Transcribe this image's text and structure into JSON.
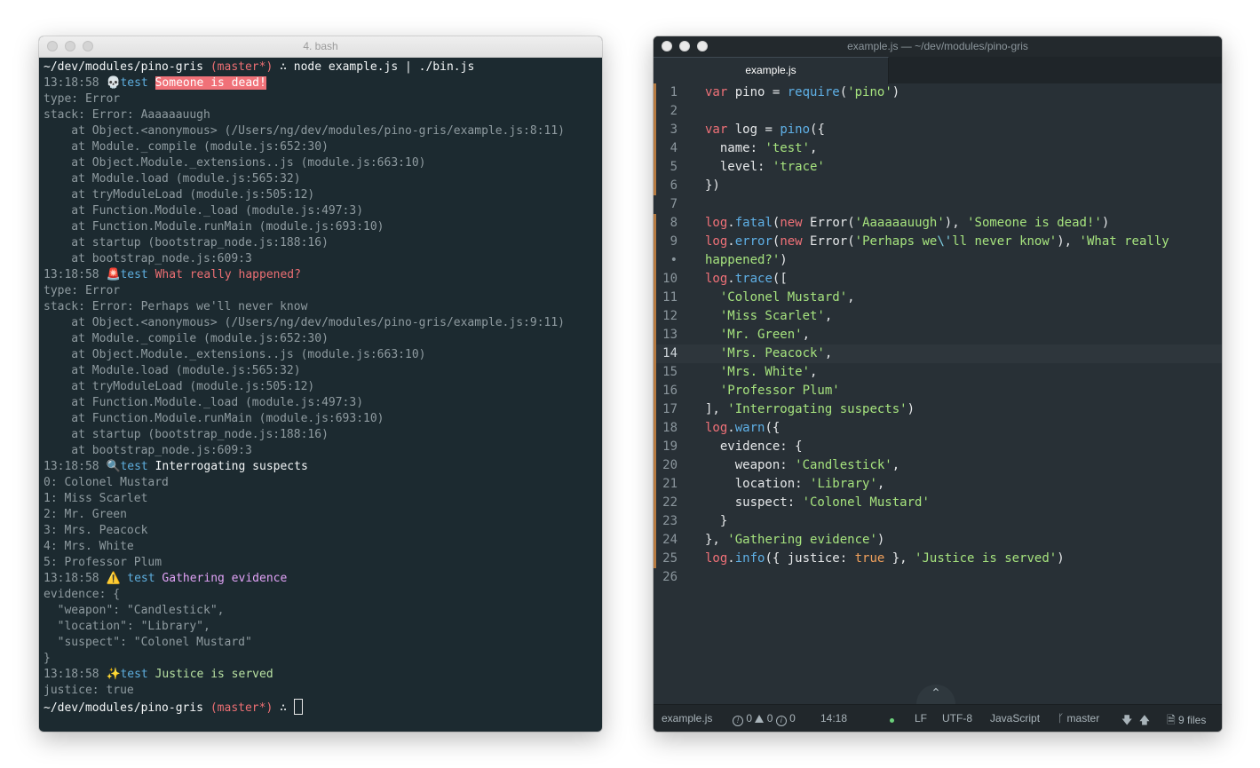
{
  "terminal": {
    "title": "4. bash",
    "lines": [
      {
        "segs": [
          {
            "t": "~/dev/modules/pino-gris ",
            "c": "wht"
          },
          {
            "t": "(master*)",
            "c": "pink"
          },
          {
            "t": " ∴ node example.js | ./bin.js",
            "c": "wht"
          }
        ]
      },
      {
        "segs": [
          {
            "t": "13:18:58 ",
            "c": "dim"
          },
          {
            "t": "💀",
            "c": "emo"
          },
          {
            "t": "test",
            "c": "blue"
          },
          {
            "t": " ",
            "c": "dim"
          },
          {
            "t": "Someone is dead!",
            "c": "hl"
          }
        ]
      },
      {
        "segs": [
          {
            "t": "type: Error",
            "c": "dim"
          }
        ]
      },
      {
        "segs": [
          {
            "t": "stack: Error: Aaaaaauugh",
            "c": "dim"
          }
        ]
      },
      {
        "segs": [
          {
            "t": "    at Object.<anonymous> (/Users/ng/dev/modules/pino-gris/example.js:8:11)",
            "c": "dim"
          }
        ]
      },
      {
        "segs": [
          {
            "t": "    at Module._compile (module.js:652:30)",
            "c": "dim"
          }
        ]
      },
      {
        "segs": [
          {
            "t": "    at Object.Module._extensions..js (module.js:663:10)",
            "c": "dim"
          }
        ]
      },
      {
        "segs": [
          {
            "t": "    at Module.load (module.js:565:32)",
            "c": "dim"
          }
        ]
      },
      {
        "segs": [
          {
            "t": "    at tryModuleLoad (module.js:505:12)",
            "c": "dim"
          }
        ]
      },
      {
        "segs": [
          {
            "t": "    at Function.Module._load (module.js:497:3)",
            "c": "dim"
          }
        ]
      },
      {
        "segs": [
          {
            "t": "    at Function.Module.runMain (module.js:693:10)",
            "c": "dim"
          }
        ]
      },
      {
        "segs": [
          {
            "t": "    at startup (bootstrap_node.js:188:16)",
            "c": "dim"
          }
        ]
      },
      {
        "segs": [
          {
            "t": "    at bootstrap_node.js:609:3",
            "c": "dim"
          }
        ]
      },
      {
        "segs": [
          {
            "t": "13:18:58 ",
            "c": "dim"
          },
          {
            "t": "🚨",
            "c": "emo"
          },
          {
            "t": "test",
            "c": "blue"
          },
          {
            "t": " What really happened?",
            "c": "pink"
          }
        ]
      },
      {
        "segs": [
          {
            "t": "type: Error",
            "c": "dim"
          }
        ]
      },
      {
        "segs": [
          {
            "t": "stack: Error: Perhaps we'll never know",
            "c": "dim"
          }
        ]
      },
      {
        "segs": [
          {
            "t": "    at Object.<anonymous> (/Users/ng/dev/modules/pino-gris/example.js:9:11)",
            "c": "dim"
          }
        ]
      },
      {
        "segs": [
          {
            "t": "    at Module._compile (module.js:652:30)",
            "c": "dim"
          }
        ]
      },
      {
        "segs": [
          {
            "t": "    at Object.Module._extensions..js (module.js:663:10)",
            "c": "dim"
          }
        ]
      },
      {
        "segs": [
          {
            "t": "    at Module.load (module.js:565:32)",
            "c": "dim"
          }
        ]
      },
      {
        "segs": [
          {
            "t": "    at tryModuleLoad (module.js:505:12)",
            "c": "dim"
          }
        ]
      },
      {
        "segs": [
          {
            "t": "    at Function.Module._load (module.js:497:3)",
            "c": "dim"
          }
        ]
      },
      {
        "segs": [
          {
            "t": "    at Function.Module.runMain (module.js:693:10)",
            "c": "dim"
          }
        ]
      },
      {
        "segs": [
          {
            "t": "    at startup (bootstrap_node.js:188:16)",
            "c": "dim"
          }
        ]
      },
      {
        "segs": [
          {
            "t": "    at bootstrap_node.js:609:3",
            "c": "dim"
          }
        ]
      },
      {
        "segs": [
          {
            "t": "13:18:58 ",
            "c": "dim"
          },
          {
            "t": "🔍",
            "c": "emo"
          },
          {
            "t": "test",
            "c": "blue"
          },
          {
            "t": " Interrogating suspects",
            "c": "wht"
          }
        ]
      },
      {
        "segs": [
          {
            "t": "0: Colonel Mustard",
            "c": "dim"
          }
        ]
      },
      {
        "segs": [
          {
            "t": "1: Miss Scarlet",
            "c": "dim"
          }
        ]
      },
      {
        "segs": [
          {
            "t": "2: Mr. Green",
            "c": "dim"
          }
        ]
      },
      {
        "segs": [
          {
            "t": "3: Mrs. Peacock",
            "c": "dim"
          }
        ]
      },
      {
        "segs": [
          {
            "t": "4: Mrs. White",
            "c": "dim"
          }
        ]
      },
      {
        "segs": [
          {
            "t": "5: Professor Plum",
            "c": "dim"
          }
        ]
      },
      {
        "segs": [
          {
            "t": "13:18:58 ",
            "c": "dim"
          },
          {
            "t": "⚠️",
            "c": "emo"
          },
          {
            "t": " test",
            "c": "blue"
          },
          {
            "t": " Gathering evidence",
            "c": "lav"
          }
        ]
      },
      {
        "segs": [
          {
            "t": "evidence: {",
            "c": "dim"
          }
        ]
      },
      {
        "segs": [
          {
            "t": "  \"weapon\": \"Candlestick\",",
            "c": "dim"
          }
        ]
      },
      {
        "segs": [
          {
            "t": "  \"location\": \"Library\",",
            "c": "dim"
          }
        ]
      },
      {
        "segs": [
          {
            "t": "  \"suspect\": \"Colonel Mustard\"",
            "c": "dim"
          }
        ]
      },
      {
        "segs": [
          {
            "t": "}",
            "c": "dim"
          }
        ]
      },
      {
        "segs": [
          {
            "t": "13:18:58 ",
            "c": "dim"
          },
          {
            "t": "✨",
            "c": "emo"
          },
          {
            "t": "test",
            "c": "blue"
          },
          {
            "t": " Justice is served",
            "c": "lgreen"
          }
        ]
      },
      {
        "segs": [
          {
            "t": "justice: true",
            "c": "dim"
          }
        ]
      },
      {
        "segs": [
          {
            "t": "~/dev/modules/pino-gris ",
            "c": "wht"
          },
          {
            "t": "(master*)",
            "c": "pink"
          },
          {
            "t": " ∴ ",
            "c": "wht"
          }
        ],
        "cursor": true
      }
    ]
  },
  "editor": {
    "title": "example.js — ~/dev/modules/pino-gris",
    "tab": "example.js",
    "lines": [
      {
        "n": "1",
        "mod": true,
        "segs": [
          {
            "t": "var",
            "c": "k"
          },
          {
            "t": " pino = ",
            "c": "p"
          },
          {
            "t": "require",
            "c": "f"
          },
          {
            "t": "(",
            "c": "p"
          },
          {
            "t": "'pino'",
            "c": "s"
          },
          {
            "t": ")",
            "c": "p"
          }
        ]
      },
      {
        "n": "2",
        "mod": true,
        "segs": [
          {
            "t": "",
            "c": "p"
          }
        ]
      },
      {
        "n": "3",
        "mod": true,
        "segs": [
          {
            "t": "var",
            "c": "k"
          },
          {
            "t": " log = ",
            "c": "p"
          },
          {
            "t": "pino",
            "c": "f"
          },
          {
            "t": "({",
            "c": "p"
          }
        ]
      },
      {
        "n": "4",
        "mod": true,
        "segs": [
          {
            "t": "  name: ",
            "c": "p"
          },
          {
            "t": "'test'",
            "c": "s"
          },
          {
            "t": ",",
            "c": "p"
          }
        ]
      },
      {
        "n": "5",
        "mod": true,
        "segs": [
          {
            "t": "  level: ",
            "c": "p"
          },
          {
            "t": "'trace'",
            "c": "s"
          }
        ]
      },
      {
        "n": "6",
        "mod": true,
        "segs": [
          {
            "t": "})",
            "c": "p"
          }
        ]
      },
      {
        "n": "7",
        "mod": false,
        "segs": [
          {
            "t": "",
            "c": "p"
          }
        ]
      },
      {
        "n": "8",
        "mod": true,
        "segs": [
          {
            "t": "log",
            "c": "k"
          },
          {
            "t": ".",
            "c": "p"
          },
          {
            "t": "fatal",
            "c": "f"
          },
          {
            "t": "(",
            "c": "p"
          },
          {
            "t": "new",
            "c": "k"
          },
          {
            "t": " Error(",
            "c": "p"
          },
          {
            "t": "'Aaaaaauugh'",
            "c": "s"
          },
          {
            "t": "), ",
            "c": "p"
          },
          {
            "t": "'Someone is dead!'",
            "c": "s"
          },
          {
            "t": ")",
            "c": "p"
          }
        ]
      },
      {
        "n": "9",
        "mod": true,
        "segs": [
          {
            "t": "log",
            "c": "k"
          },
          {
            "t": ".",
            "c": "p"
          },
          {
            "t": "error",
            "c": "f"
          },
          {
            "t": "(",
            "c": "p"
          },
          {
            "t": "new",
            "c": "k"
          },
          {
            "t": " Error(",
            "c": "p"
          },
          {
            "t": "'Perhaps we",
            "c": "s"
          },
          {
            "t": "\\'",
            "c": "esc"
          },
          {
            "t": "ll never know'",
            "c": "s"
          },
          {
            "t": "), ",
            "c": "p"
          },
          {
            "t": "'What really",
            "c": "s"
          }
        ]
      },
      {
        "n": "•",
        "mod": true,
        "segs": [
          {
            "t": "happened?'",
            "c": "s"
          },
          {
            "t": ")",
            "c": "p"
          }
        ]
      },
      {
        "n": "10",
        "mod": true,
        "segs": [
          {
            "t": "log",
            "c": "k"
          },
          {
            "t": ".",
            "c": "p"
          },
          {
            "t": "trace",
            "c": "f"
          },
          {
            "t": "([",
            "c": "p"
          }
        ]
      },
      {
        "n": "11",
        "mod": true,
        "segs": [
          {
            "t": "  ",
            "c": "p"
          },
          {
            "t": "'Colonel Mustard'",
            "c": "s"
          },
          {
            "t": ",",
            "c": "p"
          }
        ]
      },
      {
        "n": "12",
        "mod": true,
        "segs": [
          {
            "t": "  ",
            "c": "p"
          },
          {
            "t": "'Miss Scarlet'",
            "c": "s"
          },
          {
            "t": ",",
            "c": "p"
          }
        ]
      },
      {
        "n": "13",
        "mod": true,
        "segs": [
          {
            "t": "  ",
            "c": "p"
          },
          {
            "t": "'Mr. Green'",
            "c": "s"
          },
          {
            "t": ",",
            "c": "p"
          }
        ]
      },
      {
        "n": "14",
        "mod": true,
        "cur": true,
        "segs": [
          {
            "t": "  ",
            "c": "p"
          },
          {
            "t": "'Mrs. Peacock'",
            "c": "s"
          },
          {
            "t": ",",
            "c": "p"
          }
        ]
      },
      {
        "n": "15",
        "mod": true,
        "segs": [
          {
            "t": "  ",
            "c": "p"
          },
          {
            "t": "'Mrs. White'",
            "c": "s"
          },
          {
            "t": ",",
            "c": "p"
          }
        ]
      },
      {
        "n": "16",
        "mod": true,
        "segs": [
          {
            "t": "  ",
            "c": "p"
          },
          {
            "t": "'Professor Plum'",
            "c": "s"
          }
        ]
      },
      {
        "n": "17",
        "mod": true,
        "segs": [
          {
            "t": "], ",
            "c": "p"
          },
          {
            "t": "'Interrogating suspects'",
            "c": "s"
          },
          {
            "t": ")",
            "c": "p"
          }
        ]
      },
      {
        "n": "18",
        "mod": true,
        "segs": [
          {
            "t": "log",
            "c": "k"
          },
          {
            "t": ".",
            "c": "p"
          },
          {
            "t": "warn",
            "c": "f"
          },
          {
            "t": "({",
            "c": "p"
          }
        ]
      },
      {
        "n": "19",
        "mod": true,
        "segs": [
          {
            "t": "  evidence: {",
            "c": "p"
          }
        ]
      },
      {
        "n": "20",
        "mod": true,
        "segs": [
          {
            "t": "    weapon: ",
            "c": "p"
          },
          {
            "t": "'Candlestick'",
            "c": "s"
          },
          {
            "t": ",",
            "c": "p"
          }
        ]
      },
      {
        "n": "21",
        "mod": true,
        "segs": [
          {
            "t": "    location: ",
            "c": "p"
          },
          {
            "t": "'Library'",
            "c": "s"
          },
          {
            "t": ",",
            "c": "p"
          }
        ]
      },
      {
        "n": "22",
        "mod": true,
        "segs": [
          {
            "t": "    suspect: ",
            "c": "p"
          },
          {
            "t": "'Colonel Mustard'",
            "c": "s"
          }
        ]
      },
      {
        "n": "23",
        "mod": true,
        "segs": [
          {
            "t": "  }",
            "c": "p"
          }
        ]
      },
      {
        "n": "24",
        "mod": true,
        "segs": [
          {
            "t": "}, ",
            "c": "p"
          },
          {
            "t": "'Gathering evidence'",
            "c": "s"
          },
          {
            "t": ")",
            "c": "p"
          }
        ]
      },
      {
        "n": "25",
        "mod": true,
        "segs": [
          {
            "t": "log",
            "c": "k"
          },
          {
            "t": ".",
            "c": "p"
          },
          {
            "t": "info",
            "c": "f"
          },
          {
            "t": "({ justice: ",
            "c": "p"
          },
          {
            "t": "true",
            "c": "tr"
          },
          {
            "t": " }, ",
            "c": "p"
          },
          {
            "t": "'Justice is served'",
            "c": "s"
          },
          {
            "t": ")",
            "c": "p"
          }
        ]
      },
      {
        "n": "26",
        "mod": false,
        "segs": [
          {
            "t": "",
            "c": "p"
          }
        ]
      }
    ],
    "status": {
      "file": "example.js",
      "errors": "0",
      "warnings": "0",
      "infos": "0",
      "cursor": "14:18",
      "line_ending": "LF",
      "encoding": "UTF-8",
      "grammar": "JavaScript",
      "branch": "master",
      "files": "9 files"
    }
  }
}
